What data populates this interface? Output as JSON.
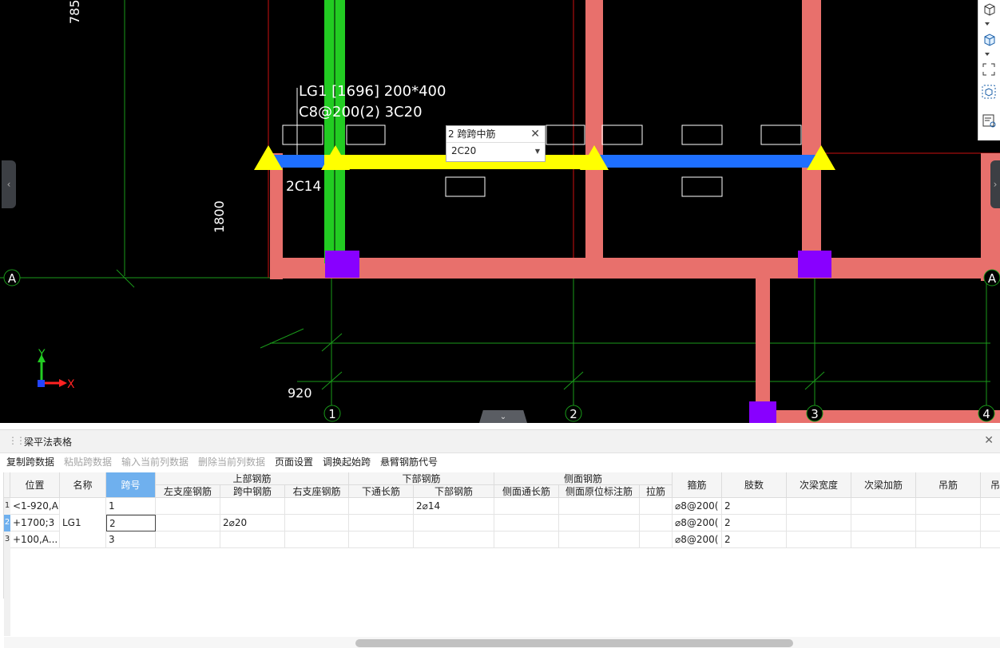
{
  "canvas": {
    "beam_label_line1": "LG1 [1696] 200*400",
    "beam_label_line2": "C8@200(2) 3C20",
    "bottom_rebar_label": "2C14",
    "dim_top": "785",
    "dim_left": "1800",
    "dim_bottom": "920",
    "axis_A_left": "A",
    "axis_A_right": "A",
    "axis_1": "1",
    "axis_2": "2",
    "axis_3": "3",
    "axis_4": "4",
    "ucs_y": "Y",
    "ucs_x": "X",
    "colors": {
      "background": "#000000",
      "beam": "#e8706c",
      "column": "#8800ff",
      "selected_beam": "#ffff00",
      "span_blue": "#1e6fff",
      "green_wall": "#22cc22"
    }
  },
  "popup": {
    "title": "2 跨跨中筋",
    "value": "2C20"
  },
  "view_toolbar": {
    "icons": [
      "cube-view-icon",
      "cube-solid-icon",
      "fit-view-icon",
      "3d-orbit-icon",
      "view-settings-icon"
    ]
  },
  "panel": {
    "title": "梁平法表格",
    "toolbar": {
      "copy_span": "复制跨数据",
      "paste_span": "粘贴跨数据",
      "input_col": "输入当前列数据",
      "delete_col": "删除当前列数据",
      "page_setup": "页面设置",
      "swap_start": "调换起始跨",
      "cantilever": "悬臂钢筋代号"
    },
    "headers": {
      "position": "位置",
      "name": "名称",
      "span": "跨号",
      "top_group": "上部钢筋",
      "top_left": "左支座钢筋",
      "top_mid": "跨中钢筋",
      "top_right": "右支座钢筋",
      "bottom_group": "下部钢筋",
      "bottom_through": "下通长筋",
      "bottom_rebar": "下部钢筋",
      "side_group": "侧面钢筋",
      "side_through": "侧面通长筋",
      "side_orig": "侧面原位标注筋",
      "tie": "拉筋",
      "stirrup": "箍筋",
      "legs": "肢数",
      "sec_width": "次梁宽度",
      "sec_add": "次梁加筋",
      "hanger": "吊筋",
      "more": "吊"
    },
    "rows": [
      {
        "num": "1",
        "position": "<1-920,A",
        "span": "1",
        "top_mid": "",
        "bottom_rebar": "2⌀14",
        "stirrup": "⌀8@200(",
        "legs": "2"
      },
      {
        "num": "2",
        "position": "+1700;3",
        "span": "2",
        "top_mid": "2⌀20",
        "bottom_rebar": "",
        "stirrup": "⌀8@200(",
        "legs": "2"
      },
      {
        "num": "3",
        "position": "+100,A...",
        "span": "3",
        "top_mid": "",
        "bottom_rebar": "",
        "stirrup": "⌀8@200(",
        "legs": "2"
      }
    ],
    "name_value": "LG1"
  }
}
